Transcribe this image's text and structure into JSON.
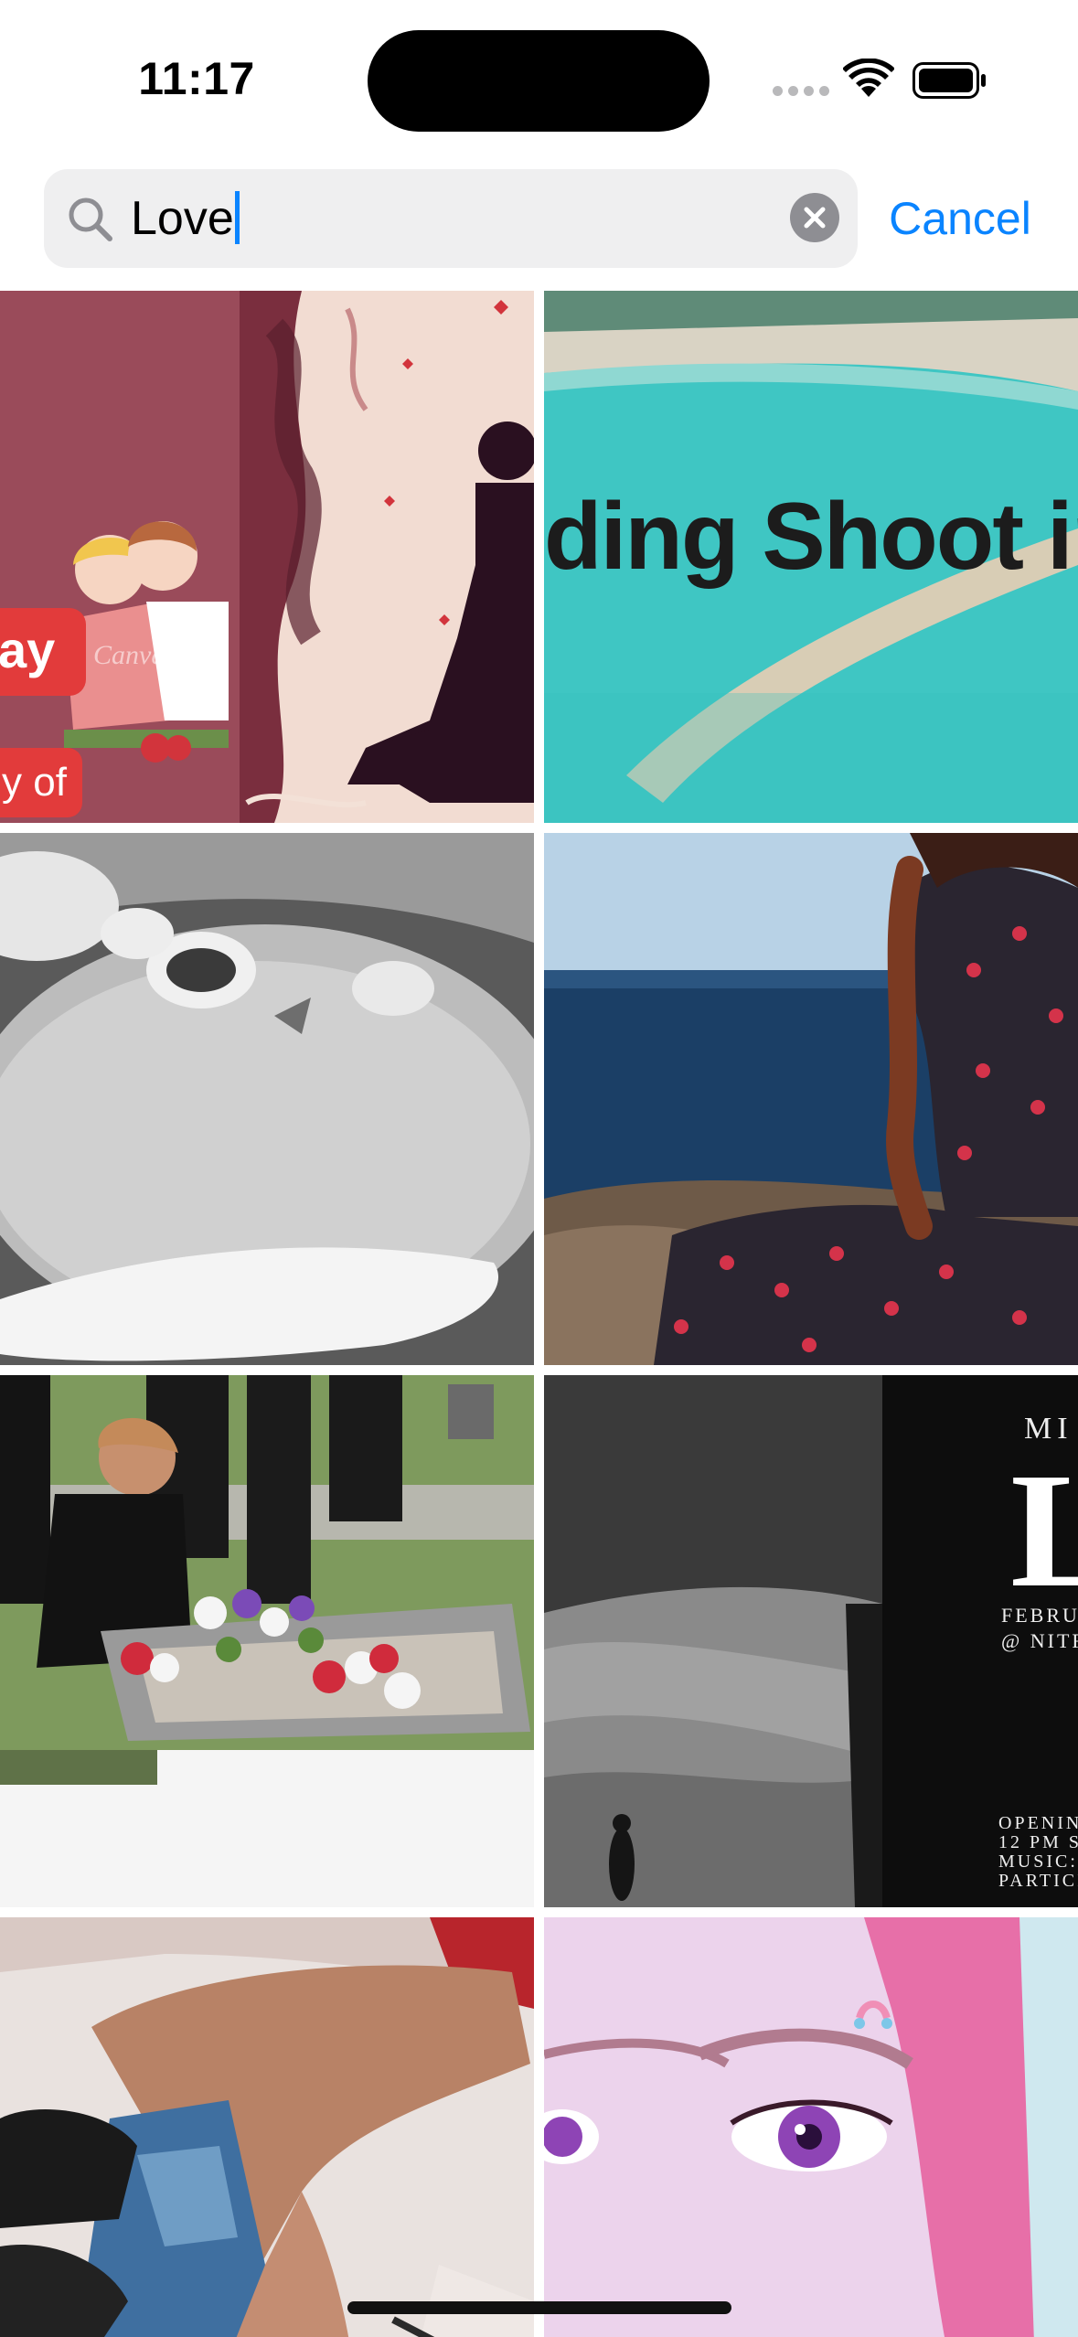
{
  "status_bar": {
    "time": "11:17",
    "icons": [
      "cellular-signal-icon",
      "wifi-icon",
      "battery-icon"
    ]
  },
  "search": {
    "query": "Love",
    "cancel_label": "Cancel",
    "icons": [
      "search-icon",
      "clear-icon"
    ]
  },
  "results": {
    "tiles": [
      {
        "id": "couple-illustration",
        "texts": [
          "ay",
          "y of",
          "Canva"
        ]
      },
      {
        "id": "lagoon",
        "texts": [
          "ding Shoot in K"
        ]
      },
      {
        "id": "rice-dish",
        "texts": []
      },
      {
        "id": "seaside-woman",
        "texts": []
      },
      {
        "id": "graveside-flowers",
        "texts": []
      },
      {
        "id": "event-poster",
        "texts": [
          "MI",
          "L",
          "FEBRUA",
          "@ NITRO",
          "OPENIN",
          "12 PM S",
          "MUSIC:",
          "PARTICI"
        ]
      },
      {
        "id": "legs-closeup",
        "texts": []
      },
      {
        "id": "pink-hair-portrait",
        "texts": []
      }
    ]
  },
  "colors": {
    "accent": "#0a84ff",
    "search_field_bg": "#efeff0",
    "badge_red": "#e23b3b"
  }
}
